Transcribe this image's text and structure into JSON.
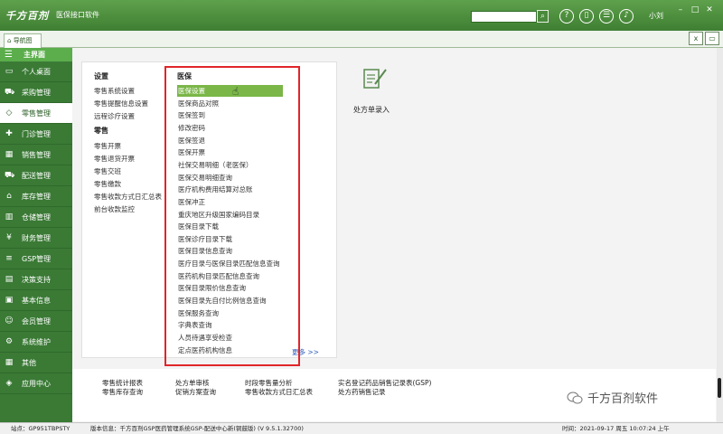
{
  "app": {
    "logo": "千方百剂",
    "title": "医保接口软件",
    "search_placeholder": "",
    "user": "小刘"
  },
  "toolbar_icons": [
    "help-icon",
    "phone-icon",
    "chat-icon",
    "bell-icon",
    "user-icon"
  ],
  "nav_tab": "导航图",
  "sidebar": {
    "header": "主界面",
    "items": [
      {
        "label": "个人桌面",
        "icon": "monitor-icon"
      },
      {
        "label": "采购管理",
        "icon": "cart-icon"
      },
      {
        "label": "零售管理",
        "icon": "tag-icon"
      },
      {
        "label": "门诊管理",
        "icon": "clinic-icon"
      },
      {
        "label": "销售管理",
        "icon": "sales-icon"
      },
      {
        "label": "配送管理",
        "icon": "truck-icon"
      },
      {
        "label": "库存管理",
        "icon": "home-icon"
      },
      {
        "label": "仓储管理",
        "icon": "warehouse-icon"
      },
      {
        "label": "财务管理",
        "icon": "yen-icon"
      },
      {
        "label": "GSP管理",
        "icon": "gsp-icon"
      },
      {
        "label": "决策支持",
        "icon": "chart-icon"
      },
      {
        "label": "基本信息",
        "icon": "info-icon"
      },
      {
        "label": "会员管理",
        "icon": "member-icon"
      },
      {
        "label": "系统维护",
        "icon": "settings-icon"
      },
      {
        "label": "其他",
        "icon": "grid-icon"
      },
      {
        "label": "应用中心",
        "icon": "app-icon"
      }
    ]
  },
  "settings_col": {
    "heading": "设置",
    "items": [
      "零售系统设置",
      "零售提醒信息设置",
      "远程诊疗设置"
    ]
  },
  "retail_col": {
    "heading": "零售",
    "items": [
      "零售开票",
      "零售退货开票",
      "零售交班",
      "零售缴款",
      "零售收款方式日汇总表",
      "前台收款监控"
    ]
  },
  "medical_col": {
    "heading": "医保",
    "items": [
      "医保设置",
      "医保商品对照",
      "医保签到",
      "修改密码",
      "医保签退",
      "医保开票",
      "社保交易明细（老医保）",
      "医保交易明细查询",
      "医疗机构费用结算对总账",
      "医保冲正",
      "重庆地区升级国家编码目录",
      "医保目录下载",
      "医保诊疗目录下载",
      "医保目录信息查询",
      "医疗目录与医保目录匹配信息查询",
      "医药机构目录匹配信息查询",
      "医保目录限价信息查询",
      "医保目录先自付比例信息查询",
      "医保服务查询",
      "字典表查询",
      "人员待遇享受检查",
      "定点医药机构信息"
    ],
    "more": "更多 >>"
  },
  "shortcut": {
    "label": "处方单录入"
  },
  "bottom_links": {
    "col1": [
      "零售统计报表",
      "零售库存查询"
    ],
    "col2": [
      "处方单审核",
      "促销方案查询"
    ],
    "col3": [
      "时段零售量分析",
      "零售收款方式日汇总表"
    ],
    "col4": [
      "实名登记药品销售记录表(GSP)",
      "处方药销售记录"
    ]
  },
  "watermark": "千方百剂软件",
  "status": {
    "site": "站点：GP951TBPSTY",
    "version": "版本信息：千方百剂GSP医药管理系统GSP-配送中心新(铜鼓版) (V 9.5.1.32700)",
    "time": "时间：2021-09-17 周五 10:07:24 上午"
  }
}
